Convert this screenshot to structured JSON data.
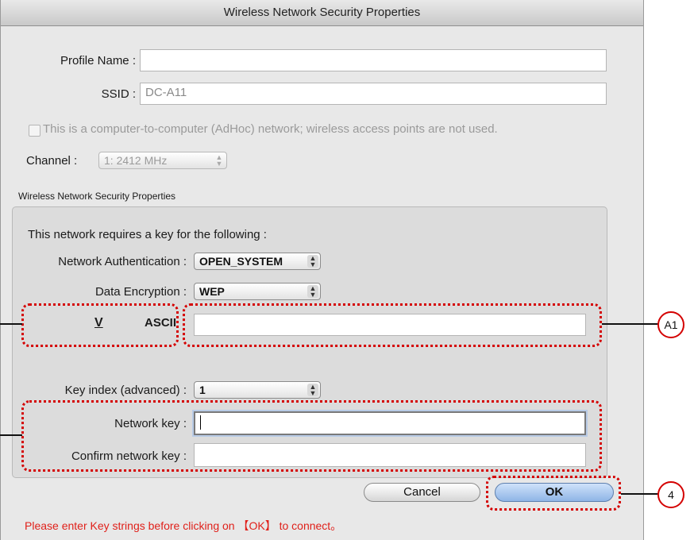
{
  "window": {
    "title": "Wireless Network Security Properties"
  },
  "profile": {
    "label": "Profile Name :",
    "value": ""
  },
  "ssid": {
    "label": "SSID :",
    "value": "DC-A11"
  },
  "adhoc": {
    "label": "This is a computer-to-computer (AdHoc) network; wireless access points are not used.",
    "checked": false
  },
  "channel": {
    "label": "Channel :",
    "value": "1: 2412 MHz"
  },
  "security": {
    "group_label": "Wireless Network Security Properties",
    "requires_text": "This network requires a key for the following :",
    "auth_label": "Network Authentication :",
    "auth_value": "OPEN_SYSTEM",
    "encryption_label": "Data Encryption :",
    "encryption_value": "WEP",
    "ascii_checkbox": "V",
    "ascii_label": "ASCII",
    "ascii_value": "",
    "key_index_label": "Key index (advanced) :",
    "key_index_value": "1",
    "network_key_label": "Network key :",
    "network_key_value": "",
    "confirm_key_label": "Confirm network key :",
    "confirm_key_value": ""
  },
  "buttons": {
    "cancel": "Cancel",
    "ok": "OK"
  },
  "notice": "Please enter Key strings before clicking on 【OK】 to connect。",
  "callouts": {
    "a1": "A1",
    "four": "4"
  },
  "colors": {
    "annotation_red": "#d40000",
    "notice_red": "#e0201a",
    "default_button": "#8fb5e6"
  }
}
